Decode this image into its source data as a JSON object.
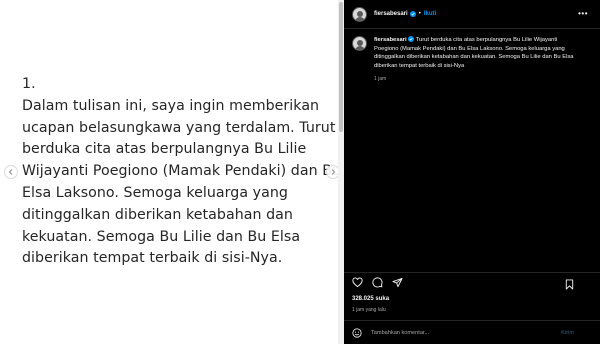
{
  "slide": {
    "lines": [
      "1.",
      "Dalam tulisan ini, saya ingin memberikan",
      "ucapan belasungkawa yang terdalam. Turut",
      "berduka cita atas berpulangnya Bu Lilie",
      "Wijayanti Poegiono (Mamak Pendaki) dan Bu",
      "Elsa Laksono. Semoga keluarga yang",
      "ditinggalkan diberikan ketabahan dan",
      "kekuatan. Semoga Bu Lilie dan Bu Elsa",
      "diberikan tempat terbaik di sisi-Nya."
    ]
  },
  "header": {
    "username": "fiersabesari",
    "separator": "•",
    "follow_label": "Ikuti",
    "more_label": "•••"
  },
  "caption": {
    "username": "fiersabesari",
    "text": "Turut berduka cita atas berpulangnya Bu Lilie Wijayanti Poegiono (Mamak Pendaki) dan Bu Elsa Laksono. Semoga keluarga yang ditinggalkan diberikan ketabahan dan kekuatan. Semoga Bu Lilie dan Bu Elsa diberikan tempat terbaik di sisi-Nya",
    "time": "1 jam"
  },
  "actions": {
    "likes": "328.025 suka",
    "time": "1 jam yang lalu"
  },
  "comment": {
    "placeholder": "Tambahkan komentar...",
    "post_label": "Kirim"
  },
  "colors": {
    "accent": "#0095f6",
    "panel_bg": "#000000",
    "slide_bg": "#ffffff"
  }
}
